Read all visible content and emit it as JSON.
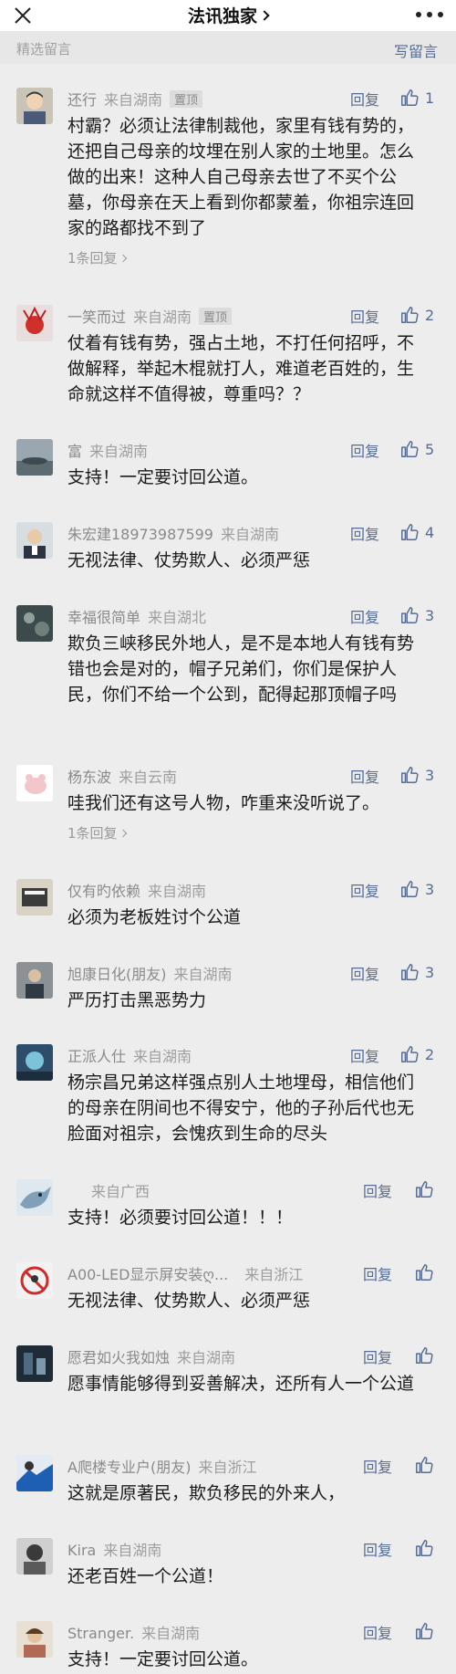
{
  "header": {
    "title": "法讯独家",
    "left_icon": "close-icon",
    "right_icon": "more-dots-icon"
  },
  "subheader": {
    "left_label": "精选留言",
    "right_label": "写留言"
  },
  "labels": {
    "reply": "回复",
    "pinned": "置顶"
  },
  "colors": {
    "link": "#576b95",
    "background": "#ededed"
  },
  "comments": [
    {
      "name": "还行",
      "location": "来自湖南",
      "pinned": "置顶",
      "likes": "1",
      "text": "村霸？必须让法律制裁他，家里有钱有势的，还把自己母亲的坟埋在别人家的土地里。怎么做的出来！这种人自己母亲去世了不买个公墓，你母亲在天上看到你都蒙羞，你祖宗连回家的路都找不到了",
      "replies": "1条回复"
    },
    {
      "name": "一笑而过",
      "location": "来自湖南",
      "pinned": "置顶",
      "likes": "2",
      "text": "仗着有钱有势，强占土地，不打任何招呼，不做解释，举起木棍就打人，难道老百姓的，生命就这样不值得被，尊重吗？？"
    },
    {
      "name": "富",
      "location": "来自湖南",
      "likes": "5",
      "text": "支持！一定要讨回公道。"
    },
    {
      "name": "朱宏建18973987599",
      "location": "来自湖南",
      "likes": "4",
      "text": "无视法律、仗势欺人、必须严惩"
    },
    {
      "name": "幸福很简单",
      "location": "来自湖北",
      "likes": "3",
      "text": "欺负三峡移民外地人，是不是本地人有钱有势错也会是对的，帽子兄弟们，你们是保护人民，你们不给一个公到，配得起那顶帽子吗"
    },
    {
      "name": "杨东波",
      "location": "来自云南",
      "likes": "3",
      "text": "哇我们还有这号人物，咋重来没听说了。",
      "replies": "1条回复"
    },
    {
      "name": "仅有旳依赖",
      "location": "来自湖南",
      "likes": "3",
      "text": "必须为老板姓讨个公道"
    },
    {
      "name": "旭康日化(朋友)",
      "location": "来自湖南",
      "likes": "3",
      "text": "严历打击黑恶势力"
    },
    {
      "name": "正派人仕",
      "location": "来自湖南",
      "likes": "2",
      "text": "杨宗昌兄弟这样强点别人土地埋母，相信他们的母亲在阴间也不得安宁，他的子孙后代也无脸面对祖宗，会愧疚到生命的尽头"
    },
    {
      "name": "",
      "location": "来自广西",
      "likes": "",
      "text": "支持！必须要讨回公道！！！"
    },
    {
      "name": "A00-LED显示屏安装ღ...",
      "location": "来自浙江",
      "likes": "",
      "text": "无视法律、仗势欺人、必须严惩"
    },
    {
      "name": "愿君如火我如烛",
      "location": "来自湖南",
      "likes": "",
      "text": "愿事情能够得到妥善解决，还所有人一个公道"
    },
    {
      "name": "A爬楼专业户(朋友)",
      "location": "来自浙江",
      "likes": "",
      "text": "这就是原著民，欺负移民的外来人，"
    },
    {
      "name": "Kira",
      "location": "来自湖南",
      "likes": "",
      "text": "还老百姓一个公道！"
    },
    {
      "name": "Stranger.",
      "location": "来自湖南",
      "likes": "",
      "text": "支持！一定要讨回公道。"
    }
  ]
}
